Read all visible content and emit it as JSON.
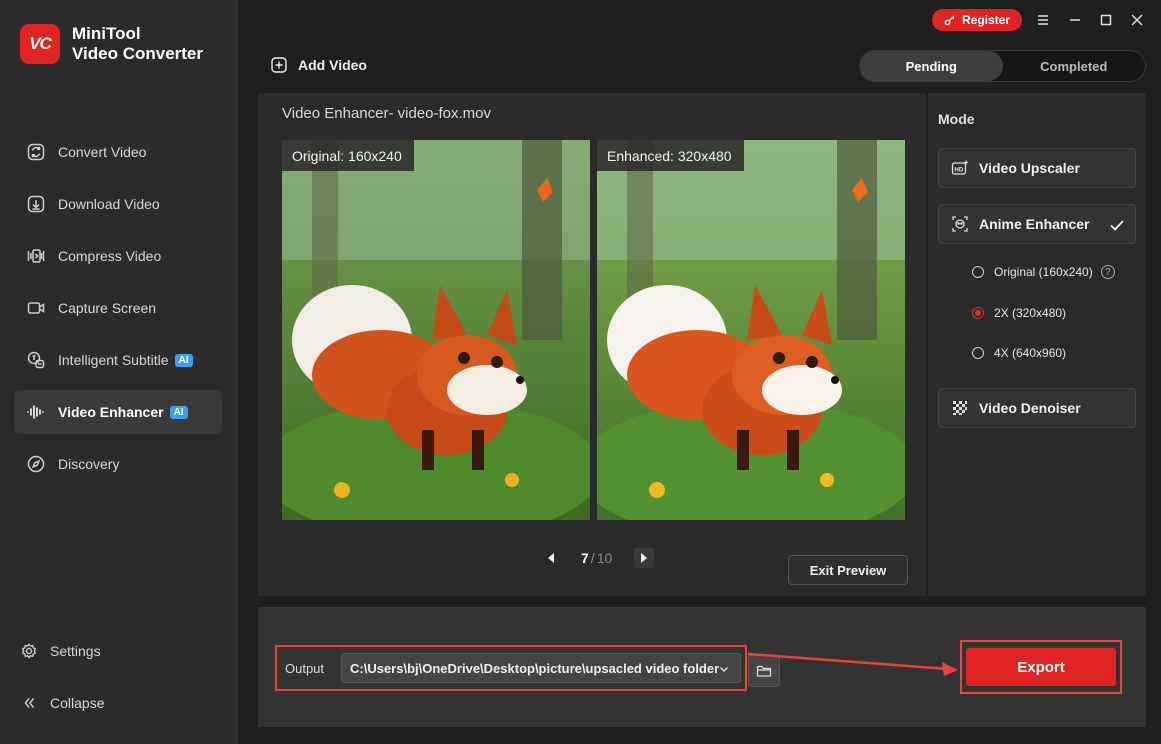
{
  "app": {
    "name_line1": "MiniTool",
    "name_line2": "Video Converter",
    "logo_text": "VC",
    "brand_color": "#e02424"
  },
  "topbar": {
    "register_label": "Register",
    "add_video_label": "Add Video",
    "tabs": [
      {
        "label": "Pending",
        "active": true
      },
      {
        "label": "Completed",
        "active": false
      }
    ]
  },
  "sidebar": {
    "items": [
      {
        "label": "Convert Video",
        "icon": "convert-icon"
      },
      {
        "label": "Download Video",
        "icon": "download-icon"
      },
      {
        "label": "Compress Video",
        "icon": "compress-icon"
      },
      {
        "label": "Capture Screen",
        "icon": "camera-icon"
      },
      {
        "label": "Intelligent Subtitle",
        "icon": "subtitle-icon",
        "badge": "AI"
      },
      {
        "label": "Video Enhancer",
        "icon": "waveform-icon",
        "badge": "AI",
        "active": true
      },
      {
        "label": "Discovery",
        "icon": "compass-icon"
      }
    ],
    "settings_label": "Settings",
    "collapse_label": "Collapse"
  },
  "preview": {
    "title": "Video Enhancer- video-fox.mov",
    "original_label": "Original: ",
    "original_res": "160x240",
    "enhanced_label": "Enhanced: ",
    "enhanced_res": "320x480",
    "current_page": "7",
    "separator": "/",
    "total_pages": "10",
    "exit_label": "Exit Preview"
  },
  "mode": {
    "title": "Mode",
    "upscaler_label": "Video Upscaler",
    "anime_label": "Anime Enhancer",
    "options": [
      {
        "label": "Original (160x240)",
        "selected": false,
        "help": "?"
      },
      {
        "label": "2X (320x480)",
        "selected": true
      },
      {
        "label": "4X (640x960)",
        "selected": false
      }
    ],
    "denoiser_label": "Video Denoiser"
  },
  "output": {
    "label": "Output",
    "path": "C:\\Users\\bj\\OneDrive\\Desktop\\picture\\upsacled video folder",
    "export_label": "Export",
    "highlight_color": "#e8453c"
  }
}
